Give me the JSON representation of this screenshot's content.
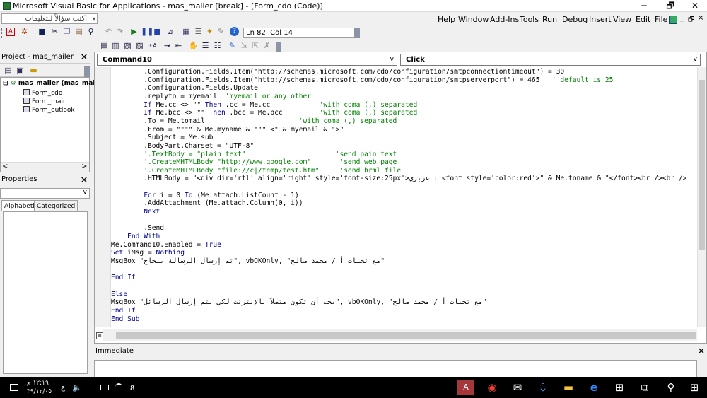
{
  "window": {
    "title": "Microsoft Visual Basic for Applications - mas_mailer [break] - [Form_cdo (Code)]",
    "minimize": "─",
    "restore": "🗗",
    "close": "✕"
  },
  "help_box": {
    "text": "اكتب سؤالاً للتعليمات",
    "arrow": "▾"
  },
  "menus": [
    "Help",
    "Window",
    "Add-Ins",
    "Tools",
    "Run",
    "Debug",
    "Insert",
    "View",
    "Edit",
    "File"
  ],
  "menu_accel": [
    "H",
    "W",
    "A",
    "T",
    "R",
    "D",
    "I",
    "V",
    "E",
    "F"
  ],
  "mdi_controls": [
    "_",
    "🗗",
    "×"
  ],
  "toolbar": {
    "location": "Ln 82, Col 14"
  },
  "project": {
    "title": "Project - mas_mailer",
    "close": "✕",
    "root": "mas_mailer (mas_mai",
    "items": [
      "Form_cdo",
      "Form_main",
      "Form_outlook"
    ],
    "scroll_left": "<",
    "scroll_right": ">"
  },
  "properties": {
    "title": "Properties",
    "close": "✕",
    "combo_arrow": "v",
    "tabs": [
      "Alphabetic",
      "Categorized"
    ]
  },
  "code": {
    "object_combo": "Command10",
    "proc_combo": "Click",
    "combo_arrow": "v",
    "lines": [
      [
        [
          "",
          "        .Configuration.Fields.Item(\"http://schemas.microsoft.com/cdo/configuration/smtpconnectiontimeout\") = 30"
        ]
      ],
      [
        [
          "",
          "        .Configuration.Fields.Item(\"http://schemas.microsoft.com/cdo/configuration/smtpserverport\") = 465   "
        ],
        [
          "cm",
          "' default is 25"
        ]
      ],
      [
        [
          "",
          "        .Configuration.Fields.Update"
        ]
      ],
      [
        [
          "",
          "        .replyto = myemail  "
        ],
        [
          "cm",
          "'myemail or any other"
        ]
      ],
      [
        [
          "",
          "        "
        ],
        [
          "kw",
          "If"
        ],
        [
          "",
          " Me.cc <> \"\" "
        ],
        [
          "kw",
          "Then"
        ],
        [
          "",
          " .cc = Me.cc            "
        ],
        [
          "cm",
          "'with coma (,) separated"
        ]
      ],
      [
        [
          "",
          "        "
        ],
        [
          "kw",
          "If"
        ],
        [
          "",
          " Me.bcc <> \"\" "
        ],
        [
          "kw",
          "Then"
        ],
        [
          "",
          " .bcc = Me.bcc         "
        ],
        [
          "cm",
          "'with coma (,) separated"
        ]
      ],
      [
        [
          "",
          "        .To = Me.tomail                       "
        ],
        [
          "cm",
          "'with coma (,) separated"
        ]
      ],
      [
        [
          "",
          "        .From = \"\"\"\" & Me.myname & \"\"\" <\" & myemail & \">\""
        ]
      ],
      [
        [
          "",
          "        .Subject = Me.sub"
        ]
      ],
      [
        [
          "",
          "        .BodyPart.Charset = \"UTF-8\""
        ]
      ],
      [
        [
          "",
          "        "
        ],
        [
          "cm",
          "'.TextBody = \"plain text\"                      'send pain text"
        ]
      ],
      [
        [
          "",
          "        "
        ],
        [
          "cm",
          "'.CreateMHTMLBody \"http://www.google.com\"       'send web page"
        ]
      ],
      [
        [
          "",
          "        "
        ],
        [
          "cm",
          "'.CreateMHTMLBody \"file://c|/temp/test.htm\"     'send hrml file"
        ]
      ],
      [
        [
          "",
          "        .HTMLBody = \"<div dir='rtl' align='right' style='font-size:25px'>عزيزي : <font style='color:red'>\" & Me.toname & \"</font><br /><br />"
        ]
      ],
      [
        [
          "",
          ""
        ]
      ],
      [
        [
          "",
          "        "
        ],
        [
          "kw",
          "For"
        ],
        [
          "",
          " i = 0 "
        ],
        [
          "kw",
          "To"
        ],
        [
          "",
          " (Me.attach.ListCount - 1)"
        ]
      ],
      [
        [
          "",
          "        .AddAttachment (Me.attach.Column(0, i))"
        ]
      ],
      [
        [
          "",
          "        "
        ],
        [
          "kw",
          "Next"
        ]
      ],
      [
        [
          "",
          ""
        ]
      ],
      [
        [
          "",
          "        .Send"
        ]
      ],
      [
        [
          "",
          "    "
        ],
        [
          "kw",
          "End With"
        ]
      ],
      [
        [
          "",
          "Me.Command10.Enabled = "
        ],
        [
          "kw",
          "True"
        ]
      ],
      [
        [
          "kw",
          "Set"
        ],
        [
          "",
          " iMsg = "
        ],
        [
          "kw",
          "Nothing"
        ]
      ],
      [
        [
          "",
          "MsgBox \"تم إرسال الرسالة بنجاح\", vbOKOnly, \"مع تحيات أ / محمد صالح\""
        ]
      ],
      [
        [
          "",
          ""
        ]
      ],
      [
        [
          "kw",
          "End If"
        ]
      ],
      [
        [
          "",
          ""
        ]
      ],
      [
        [
          "kw",
          "Else"
        ]
      ],
      [
        [
          "",
          "MsgBox \"يجب أن تكون متصلاً بالإنترنت لكي يتم إرسال الرسائل\", vbOKOnly, \"مع تحيات أ / محمد صالح\""
        ]
      ],
      [
        [
          "kw",
          "End If"
        ]
      ],
      [
        [
          "kw",
          "End Sub"
        ]
      ]
    ]
  },
  "immediate": {
    "title": "Immediate",
    "close": "✕"
  },
  "taskbar": {
    "time": "١٢:١٩ م",
    "date": "٣٩/١٢/٠٥",
    "lang": "ع"
  },
  "colors": {
    "keyword": "#00008b",
    "comment": "#008000",
    "taskbar": "#000000"
  }
}
